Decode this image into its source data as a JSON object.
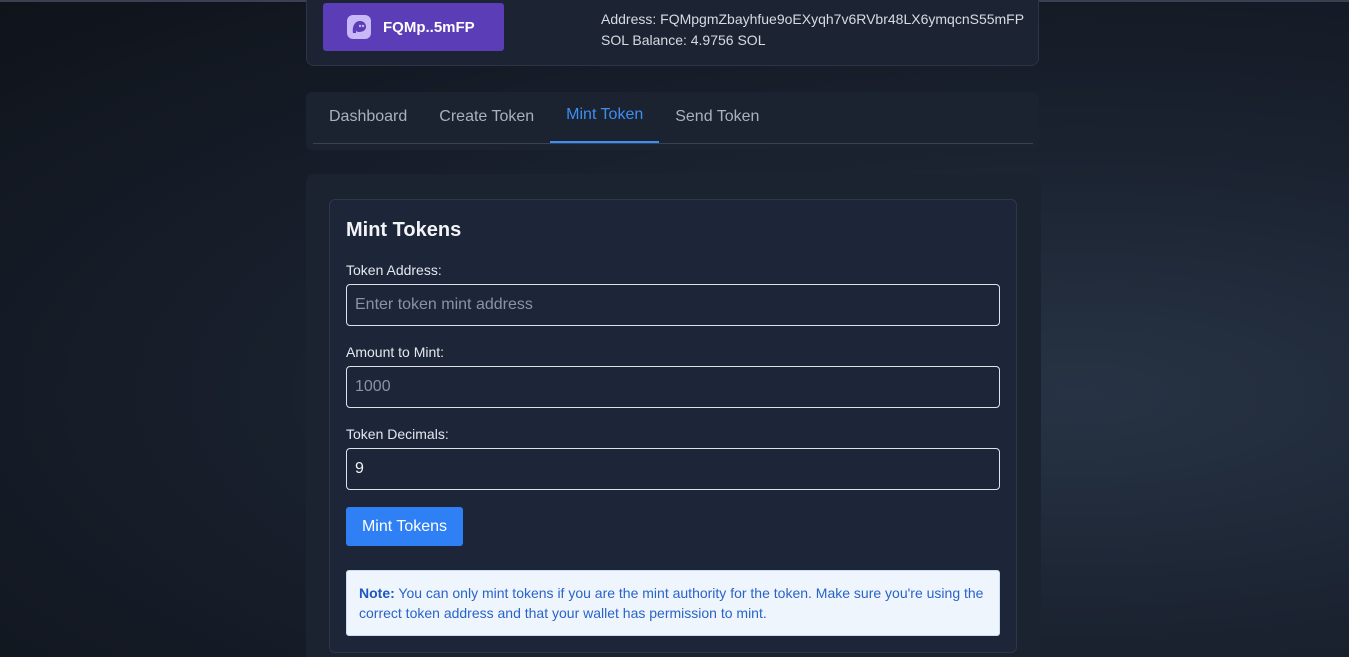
{
  "wallet": {
    "button_label": "FQMp..5mFP",
    "icon": "ghost-icon",
    "address_line": "Address: FQMpgmZbayhfue9oEXyqh7v6RVbr48LX6ymqcnS55mFP",
    "balance_line": "SOL Balance: 4.9756 SOL"
  },
  "tabs": [
    {
      "label": "Dashboard",
      "active": false
    },
    {
      "label": "Create Token",
      "active": false
    },
    {
      "label": "Mint Token",
      "active": true
    },
    {
      "label": "Send Token",
      "active": false
    }
  ],
  "form": {
    "title": "Mint Tokens",
    "token_address": {
      "label": "Token Address:",
      "placeholder": "Enter token mint address",
      "value": ""
    },
    "amount": {
      "label": "Amount to Mint:",
      "placeholder": "1000",
      "value": ""
    },
    "decimals": {
      "label": "Token Decimals:",
      "value": "9"
    },
    "submit_label": "Mint Tokens"
  },
  "note": {
    "prefix": "Note:",
    "text": " You can only mint tokens if you are the mint authority for the token. Make sure you're using the correct token address and that your wallet has permission to mint."
  },
  "colors": {
    "accent": "#3d8ef5",
    "wallet_button": "#5b3db8",
    "primary_button": "#2f80f5"
  }
}
